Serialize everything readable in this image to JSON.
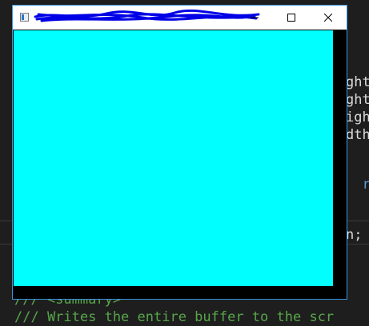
{
  "editor": {
    "lines": [
      {
        "text": "ght",
        "color": "default"
      },
      {
        "text": "ght",
        "color": "default"
      },
      {
        "text": "igh",
        "color": "default"
      },
      {
        "text": "dth",
        "color": "default"
      },
      {
        "text": "rt)",
        "color": "blue"
      },
      {
        "text": "n;",
        "color": "default"
      },
      {
        "text": "/// <summary>",
        "color": "comment"
      },
      {
        "text": "/// Writes the entire buffer to the scr",
        "color": "comment"
      }
    ],
    "colors": {
      "default": "#dcdcdc",
      "blue": "#569cd6",
      "comment": "#57a64a",
      "background": "#1e1e1e"
    }
  },
  "window": {
    "title": "",
    "title_redacted": true,
    "icon": "app-window-icon",
    "controls": {
      "minimize": "minimize-icon",
      "maximize": "maximize-icon",
      "close": "close-icon"
    },
    "client_color": "#00ffff",
    "frame_color": "#000000",
    "border_color": "#3a96dd"
  }
}
